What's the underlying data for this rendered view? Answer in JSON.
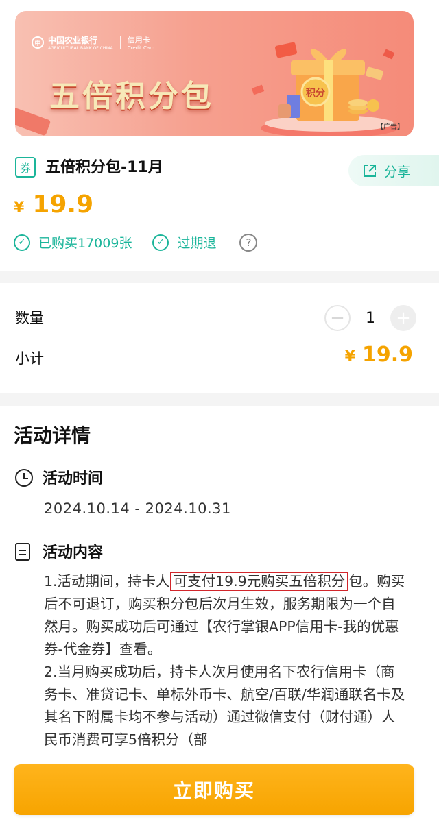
{
  "banner": {
    "bank_name": "中国农业银行",
    "bank_name_en": "AGRICULTURAL BANK OF CHINA",
    "card_type": "信用卡",
    "card_type_en": "Credit Card",
    "title": "五倍积分包",
    "gift_label": "积分",
    "ad_tag": "【广告】"
  },
  "product": {
    "badge": "券",
    "title": "五倍积分包-11月",
    "share_label": "分享",
    "currency": "¥",
    "price": "19.9",
    "tags": [
      {
        "label": "已购买17009张"
      },
      {
        "label": "过期退"
      }
    ],
    "help_icon": "?"
  },
  "order": {
    "quantity_label": "数量",
    "quantity": "1",
    "minus": "−",
    "plus": "+",
    "subtotal_label": "小计",
    "subtotal_currency": "¥",
    "subtotal": "19.9"
  },
  "details": {
    "title": "活动详情",
    "time_heading": "活动时间",
    "time_range": "2024.10.14 - 2024.10.31",
    "content_heading": "活动内容",
    "content_before": "1.活动期间，持卡人",
    "content_highlight": "可支付19.9元购买五倍积分",
    "content_after": "包。购买后不可退订，购买积分包后次月生效，服务期限为一个自然月。购买成功后可通过【农行掌银APP信用卡-我的优惠券-代金券】查看。",
    "content_item2": "2.当月购买成功后，持卡人次月使用名下农行信用卡（商务卡、准贷记卡、单标外币卡、航空/百联/华润通联名卡及其名下附属卡均不参与活动）通过微信支付（财付通）人民币消费可享5倍积分（部"
  },
  "buy_button": "立即购买",
  "colors": {
    "accent_green": "#1bb59a",
    "price_orange": "#f5a300",
    "button_orange": "#ffb41c",
    "highlight_red": "#d2262b"
  }
}
